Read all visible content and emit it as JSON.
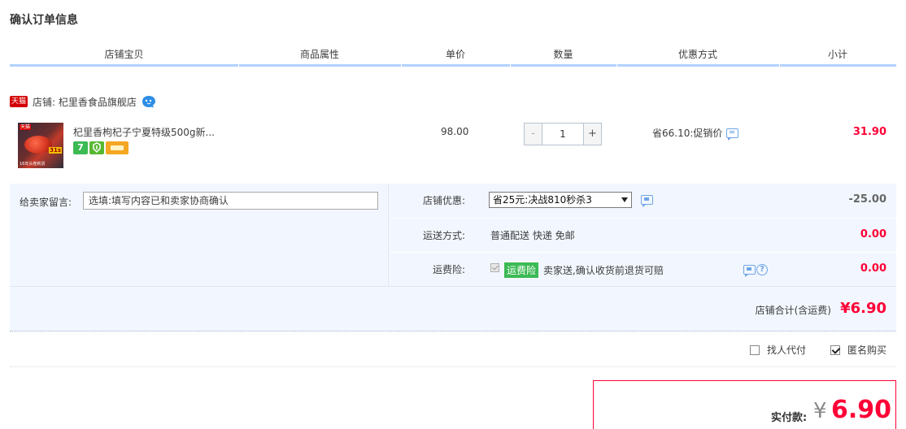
{
  "section_title": "确认订单信息",
  "columns": [
    "店铺宝贝",
    "商品属性",
    "单价",
    "数量",
    "优惠方式",
    "小计"
  ],
  "shop": {
    "badge": "天猫",
    "label": "店铺: 杞里香食品旗舰店",
    "chat_icon": "wangwang-chat-icon"
  },
  "item": {
    "thumb_tag": "天猫",
    "thumb_badge": "31s",
    "thumb_caption": "16年头茬新货",
    "title": "杞里香枸杞子宁夏特级500g新...",
    "service_icon_label": "7",
    "price": "98.00",
    "quantity": "1",
    "qty_minus": "-",
    "qty_plus": "+",
    "discount": "省66.10:促销价",
    "subtotal": "31.90"
  },
  "memo": {
    "label": "给卖家留言:",
    "placeholder": "选填:填写内容已和卖家协商确认"
  },
  "shop_coupon": {
    "label": "店铺优惠:",
    "selected": "省25元:决战810秒杀3",
    "amount": "-25.00"
  },
  "shipping": {
    "label": "运送方式:",
    "value": "普通配送 快递 免邮",
    "amount": "0.00"
  },
  "insurance": {
    "label": "运费险:",
    "badge": "运费险",
    "text": "卖家送,确认收货前退货可赔",
    "amount": "0.00"
  },
  "shop_total": {
    "label": "店铺合计(含运费)",
    "amount": "¥6.90"
  },
  "options": {
    "proxy_pay": {
      "label": "找人代付",
      "checked": false
    },
    "anonymous": {
      "label": "匿名购买",
      "checked": true
    }
  },
  "payment": {
    "label": "实付款:",
    "currency": "¥",
    "amount": "6.90"
  }
}
